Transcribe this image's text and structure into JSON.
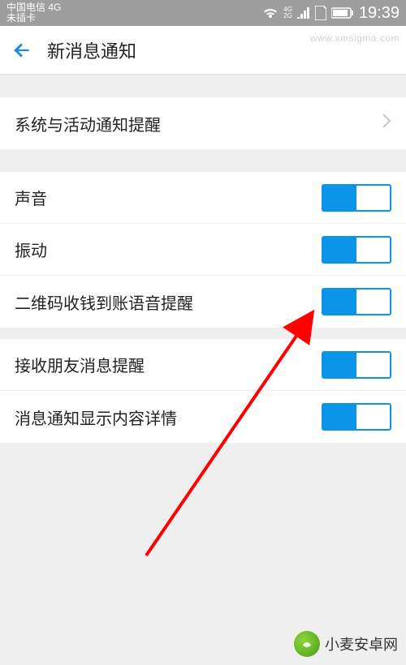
{
  "status": {
    "carrier": "中国电信 4G",
    "subtext": "未插卡",
    "net_4g": "4G",
    "net_2g": "2G",
    "time": "19:39"
  },
  "header": {
    "title": "新消息通知"
  },
  "rows": {
    "system_activity": "系统与活动通知提醒",
    "sound": "声音",
    "vibrate": "振动",
    "qr_voice": "二维码收钱到账语音提醒",
    "friend_msg": "接收朋友消息提醒",
    "show_detail": "消息通知显示内容详情"
  },
  "watermark": {
    "top_right": "www.xmsigma.com",
    "bottom_right": "小麦安卓网"
  }
}
